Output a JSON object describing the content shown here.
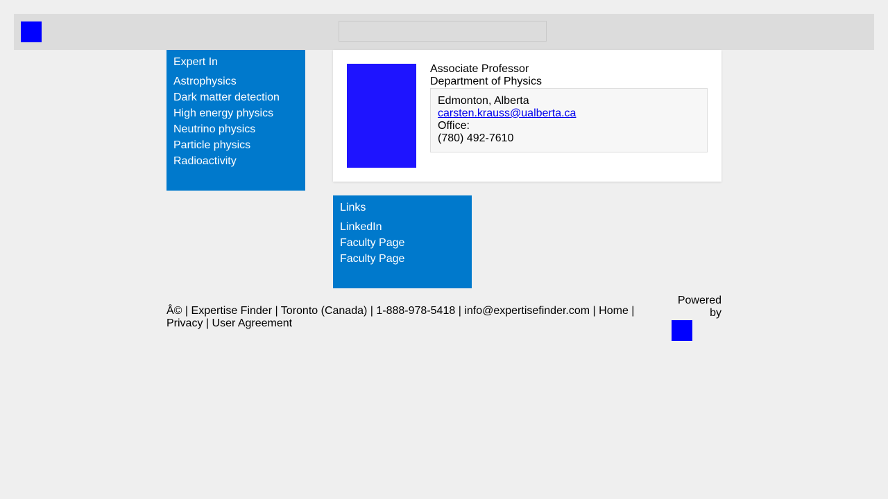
{
  "header": {
    "logo_icon": "site-logo",
    "search": {
      "placeholder": "",
      "value": ""
    }
  },
  "expert_in": {
    "title": "Expert In",
    "items": [
      "Astrophysics",
      "Dark matter detection",
      "High energy physics",
      "Neutrino physics",
      "Particle physics",
      "Radioactivity"
    ]
  },
  "profile": {
    "photo_icon": "profile-photo",
    "title": "Associate Professor",
    "department": "Department of Physics",
    "location": "Edmonton, Alberta",
    "email": "carsten.krauss@ualberta.ca",
    "office_label": "Office:",
    "phone": "(780) 492-7610"
  },
  "links": {
    "title": "Links",
    "items": [
      "LinkedIn",
      "Faculty Page",
      "Faculty Page"
    ]
  },
  "footer": {
    "copyright": "Â©",
    "company": "Expertise Finder",
    "location": "Toronto (Canada)",
    "phone": "1-888-978-5418",
    "email": "info@expertisefinder.com",
    "home": "Home",
    "privacy": "Privacy",
    "agreement": "User Agreement",
    "separator": "|",
    "powered_by": "Powered by"
  },
  "colors": {
    "accent_blue": "#0079cc",
    "logo_blue": "#0000ff",
    "photo_blue": "#1e14ff",
    "background": "#efefef",
    "header_bg": "#dcdcdc"
  }
}
